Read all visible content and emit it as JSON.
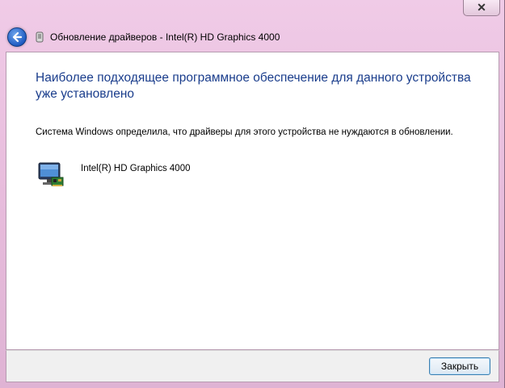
{
  "window": {
    "close_glyph": "✕"
  },
  "topbar": {
    "back_icon": "back-arrow-icon",
    "title": "Обновление драйверов - Intel(R) HD Graphics 4000"
  },
  "content": {
    "heading": "Наиболее подходящее программное обеспечение для данного устройства уже установлено",
    "description": "Система Windows определила, что драйверы для этого устройства не нуждаются в обновлении.",
    "device_icon": "display-adapter-icon",
    "device_name": "Intel(R) HD Graphics 4000"
  },
  "footer": {
    "close_label": "Закрыть"
  },
  "colors": {
    "heading": "#1a3d8c",
    "frame": "#e7bcdc",
    "button_border": "#3c7fb1"
  }
}
